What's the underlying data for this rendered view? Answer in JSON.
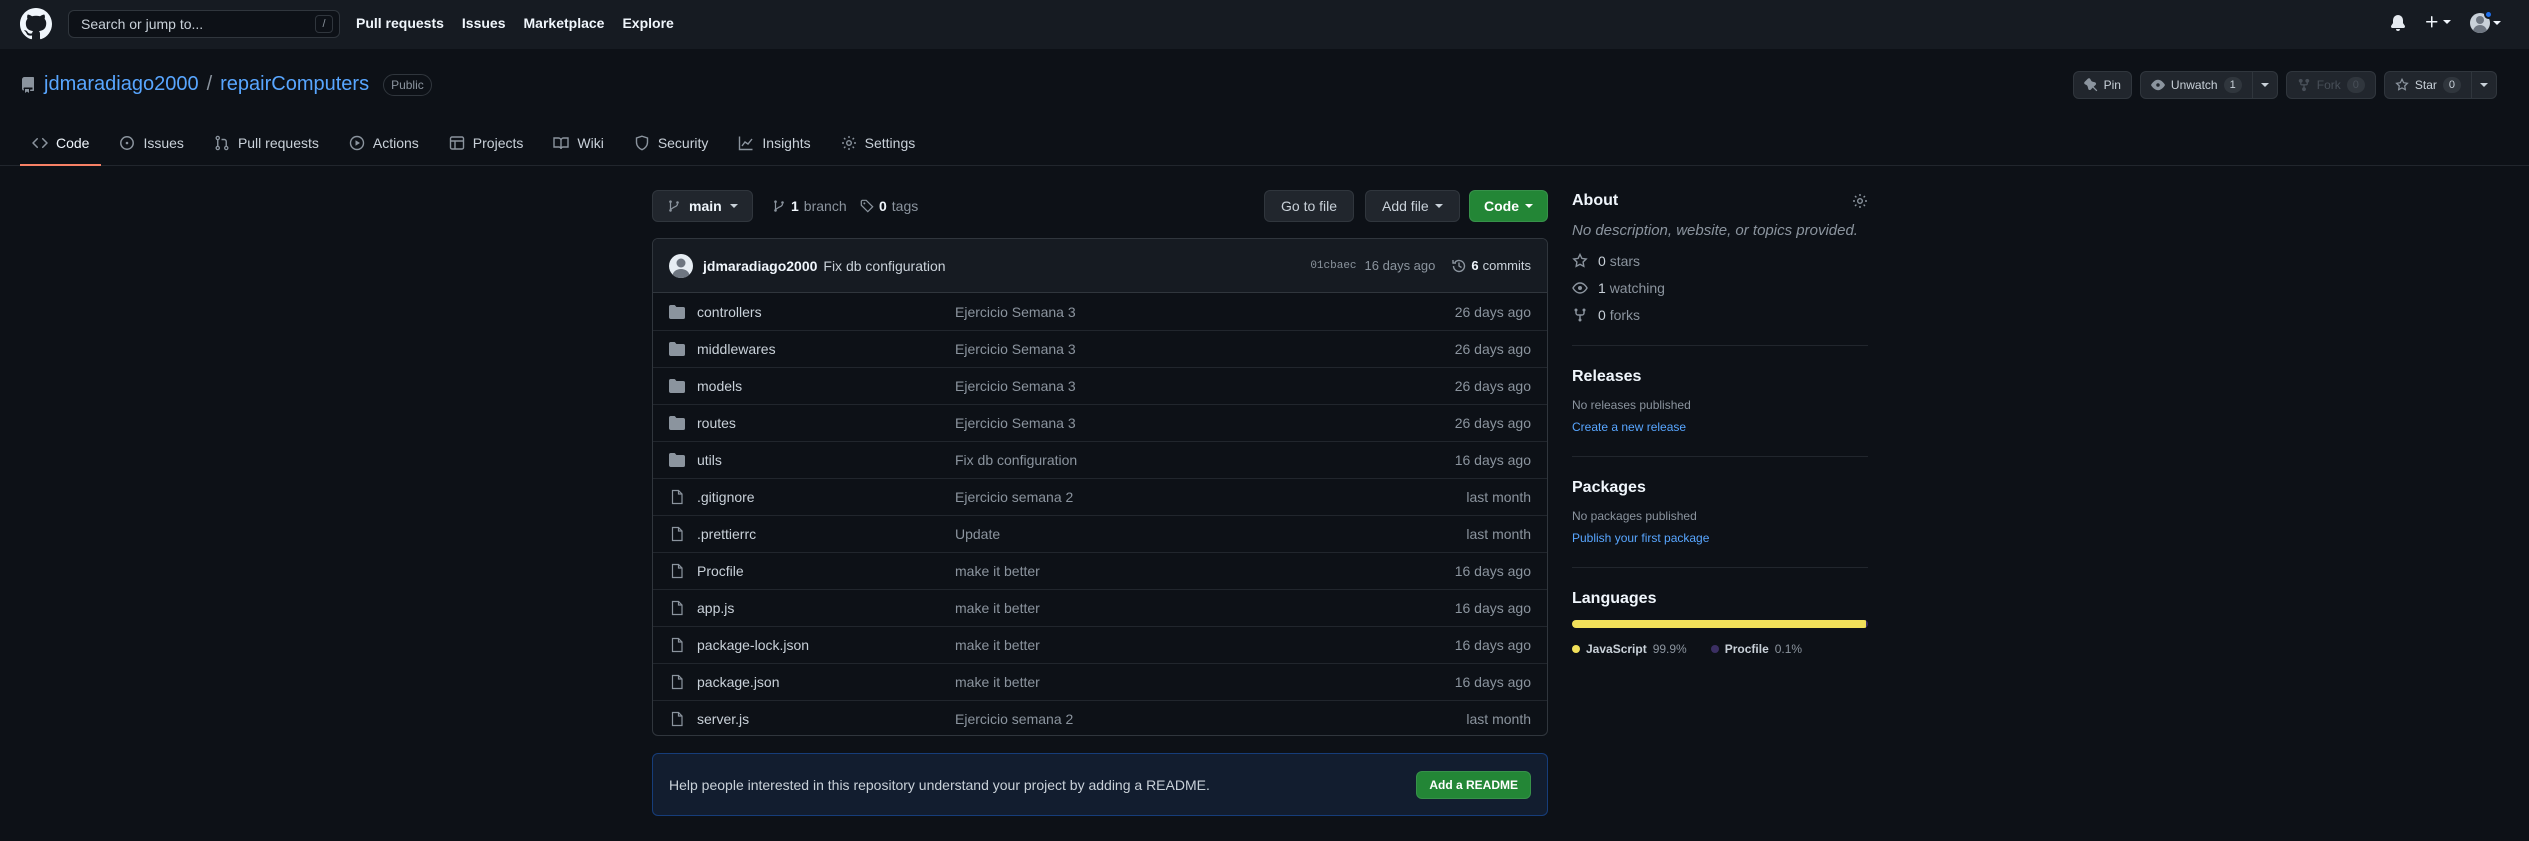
{
  "header": {
    "search_placeholder": "Search or jump to...",
    "search_shortcut": "/",
    "nav": [
      "Pull requests",
      "Issues",
      "Marketplace",
      "Explore"
    ]
  },
  "repo": {
    "owner": "jdmaradiago2000",
    "separator": "/",
    "name": "repairComputers",
    "visibility": "Public",
    "actions": {
      "pin": "Pin",
      "unwatch": "Unwatch",
      "unwatch_count": "1",
      "fork": "Fork",
      "fork_count": "0",
      "star": "Star",
      "star_count": "0"
    }
  },
  "tabs": [
    {
      "label": "Code",
      "icon": "code-icon",
      "selected": true
    },
    {
      "label": "Issues",
      "icon": "issue-icon"
    },
    {
      "label": "Pull requests",
      "icon": "pull-request-icon"
    },
    {
      "label": "Actions",
      "icon": "play-icon"
    },
    {
      "label": "Projects",
      "icon": "table-icon"
    },
    {
      "label": "Wiki",
      "icon": "book-icon"
    },
    {
      "label": "Security",
      "icon": "shield-icon"
    },
    {
      "label": "Insights",
      "icon": "graph-icon"
    },
    {
      "label": "Settings",
      "icon": "gear-icon"
    }
  ],
  "file_nav": {
    "branch": "main",
    "branch_count": "1",
    "branch_label": "branch",
    "tag_count": "0",
    "tag_label": "tags",
    "go_to_file": "Go to file",
    "add_file": "Add file",
    "code": "Code"
  },
  "latest_commit": {
    "author": "jdmaradiago2000",
    "message": "Fix db configuration",
    "sha": "01cbaec",
    "age": "16 days ago",
    "commit_count": "6",
    "commit_label": "commits"
  },
  "files": [
    {
      "name": "controllers",
      "type": "dir",
      "message": "Ejercicio Semana 3",
      "age": "26 days ago"
    },
    {
      "name": "middlewares",
      "type": "dir",
      "message": "Ejercicio Semana 3",
      "age": "26 days ago"
    },
    {
      "name": "models",
      "type": "dir",
      "message": "Ejercicio Semana 3",
      "age": "26 days ago"
    },
    {
      "name": "routes",
      "type": "dir",
      "message": "Ejercicio Semana 3",
      "age": "26 days ago"
    },
    {
      "name": "utils",
      "type": "dir",
      "message": "Fix db configuration",
      "age": "16 days ago"
    },
    {
      "name": ".gitignore",
      "type": "file",
      "message": "Ejercicio semana 2",
      "age": "last month"
    },
    {
      "name": ".prettierrc",
      "type": "file",
      "message": "Update",
      "age": "last month"
    },
    {
      "name": "Procfile",
      "type": "file",
      "message": "make it better",
      "age": "16 days ago"
    },
    {
      "name": "app.js",
      "type": "file",
      "message": "make it better",
      "age": "16 days ago"
    },
    {
      "name": "package-lock.json",
      "type": "file",
      "message": "make it better",
      "age": "16 days ago"
    },
    {
      "name": "package.json",
      "type": "file",
      "message": "make it better",
      "age": "16 days ago"
    },
    {
      "name": "server.js",
      "type": "file",
      "message": "Ejercicio semana 2",
      "age": "last month"
    }
  ],
  "readme_prompt": {
    "text": "Help people interested in this repository understand your project by adding a README.",
    "button": "Add a README"
  },
  "about": {
    "title": "About",
    "description": "No description, website, or topics provided.",
    "stars": "0",
    "stars_label": "stars",
    "watching": "1",
    "watching_label": "watching",
    "forks": "0",
    "forks_label": "forks"
  },
  "releases": {
    "title": "Releases",
    "empty": "No releases published",
    "link": "Create a new release"
  },
  "packages": {
    "title": "Packages",
    "empty": "No packages published",
    "link": "Publish your first package"
  },
  "languages": {
    "title": "Languages",
    "items": [
      {
        "name": "JavaScript",
        "percent": "99.9%",
        "value": 99.9,
        "color": "#f1e05a"
      },
      {
        "name": "Procfile",
        "percent": "0.1%",
        "value": 0.1,
        "color": "#3b2f63"
      }
    ]
  },
  "colors": {
    "accent_link": "#58a6ff",
    "primary_button": "#238636",
    "tab_underline": "#f78166"
  }
}
